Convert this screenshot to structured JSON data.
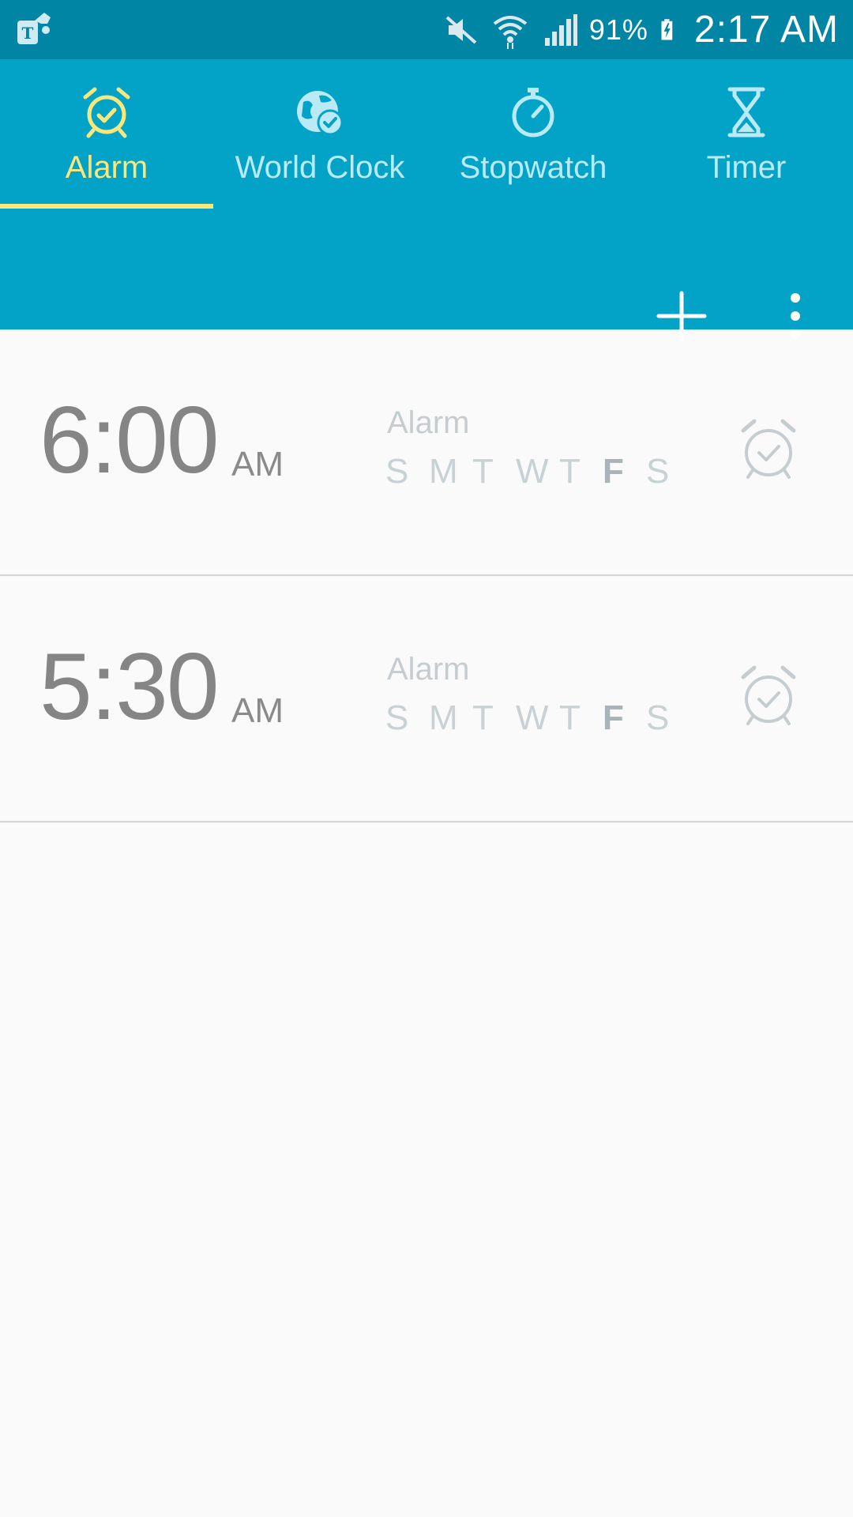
{
  "status_bar": {
    "battery": "91%",
    "time": "2:17 AM",
    "icons": [
      "t-mobile-icon",
      "mute-icon",
      "wifi-icon",
      "signal-icon",
      "battery-charging-icon"
    ]
  },
  "colors": {
    "status_bar": "#0185a4",
    "app_bar": "#03a3c7",
    "accent": "#fae77c",
    "tab_inactive": "#b9eaf5",
    "background": "#fafafa"
  },
  "tabs": [
    {
      "label": "Alarm",
      "icon": "alarm-clock-icon",
      "active": true
    },
    {
      "label": "World Clock",
      "icon": "globe-check-icon",
      "active": false
    },
    {
      "label": "Stopwatch",
      "icon": "stopwatch-icon",
      "active": false
    },
    {
      "label": "Timer",
      "icon": "hourglass-icon",
      "active": false
    }
  ],
  "toolbar": {
    "add_icon": "plus-icon",
    "more_icon": "more-vertical-icon"
  },
  "alarms": [
    {
      "time": "6:00",
      "ampm": "AM",
      "name": "Alarm",
      "days": [
        "S",
        "M",
        "T",
        "W",
        "T",
        "F",
        "S"
      ],
      "active_day": "F",
      "enabled": false
    },
    {
      "time": "5:30",
      "ampm": "AM",
      "name": "Alarm",
      "days": [
        "S",
        "M",
        "T",
        "W",
        "T",
        "F",
        "S"
      ],
      "active_day": "F",
      "enabled": false
    }
  ]
}
